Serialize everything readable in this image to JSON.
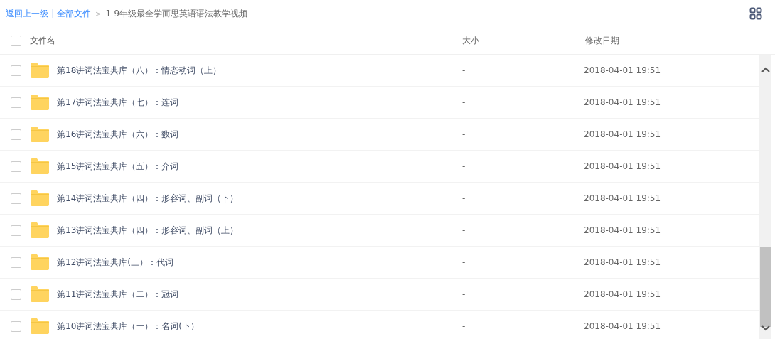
{
  "breadcrumb": {
    "back": "返回上一级",
    "separator": "|",
    "root": "全部文件",
    "arrow": ">",
    "current": "1-9年级最全学而思英语语法教学视频"
  },
  "header": {
    "checked": false,
    "columns": [
      "文件名",
      "大小",
      "修改日期"
    ]
  },
  "rows": [
    {
      "name": "第18讲词法宝典库（八）：情态动词（上）",
      "size": "-",
      "date": "2018-04-01 19:51",
      "checked": false
    },
    {
      "name": "第17讲词法宝典库（七）：连词",
      "size": "-",
      "date": "2018-04-01 19:51",
      "checked": false
    },
    {
      "name": "第16讲词法宝典库（六）：数词",
      "size": "-",
      "date": "2018-04-01 19:51",
      "checked": false
    },
    {
      "name": "第15讲词法宝典库（五）：介词",
      "size": "-",
      "date": "2018-04-01 19:51",
      "checked": false
    },
    {
      "name": "第14讲词法宝典库（四）：形容词、副词（下）",
      "size": "-",
      "date": "2018-04-01 19:51",
      "checked": false
    },
    {
      "name": "第13讲词法宝典库（四）：形容词、副词（上）",
      "size": "-",
      "date": "2018-04-01 19:51",
      "checked": false
    },
    {
      "name": "第12讲词法宝典库(三）：代词",
      "size": "-",
      "date": "2018-04-01 19:51",
      "checked": false
    },
    {
      "name": "第11讲词法宝典库（二）：冠词",
      "size": "-",
      "date": "2018-04-01 19:51",
      "checked": false
    },
    {
      "name": "第10讲词法宝典库（一）：名词(下）",
      "size": "-",
      "date": "2018-04-01 19:51",
      "checked": false
    }
  ]
}
